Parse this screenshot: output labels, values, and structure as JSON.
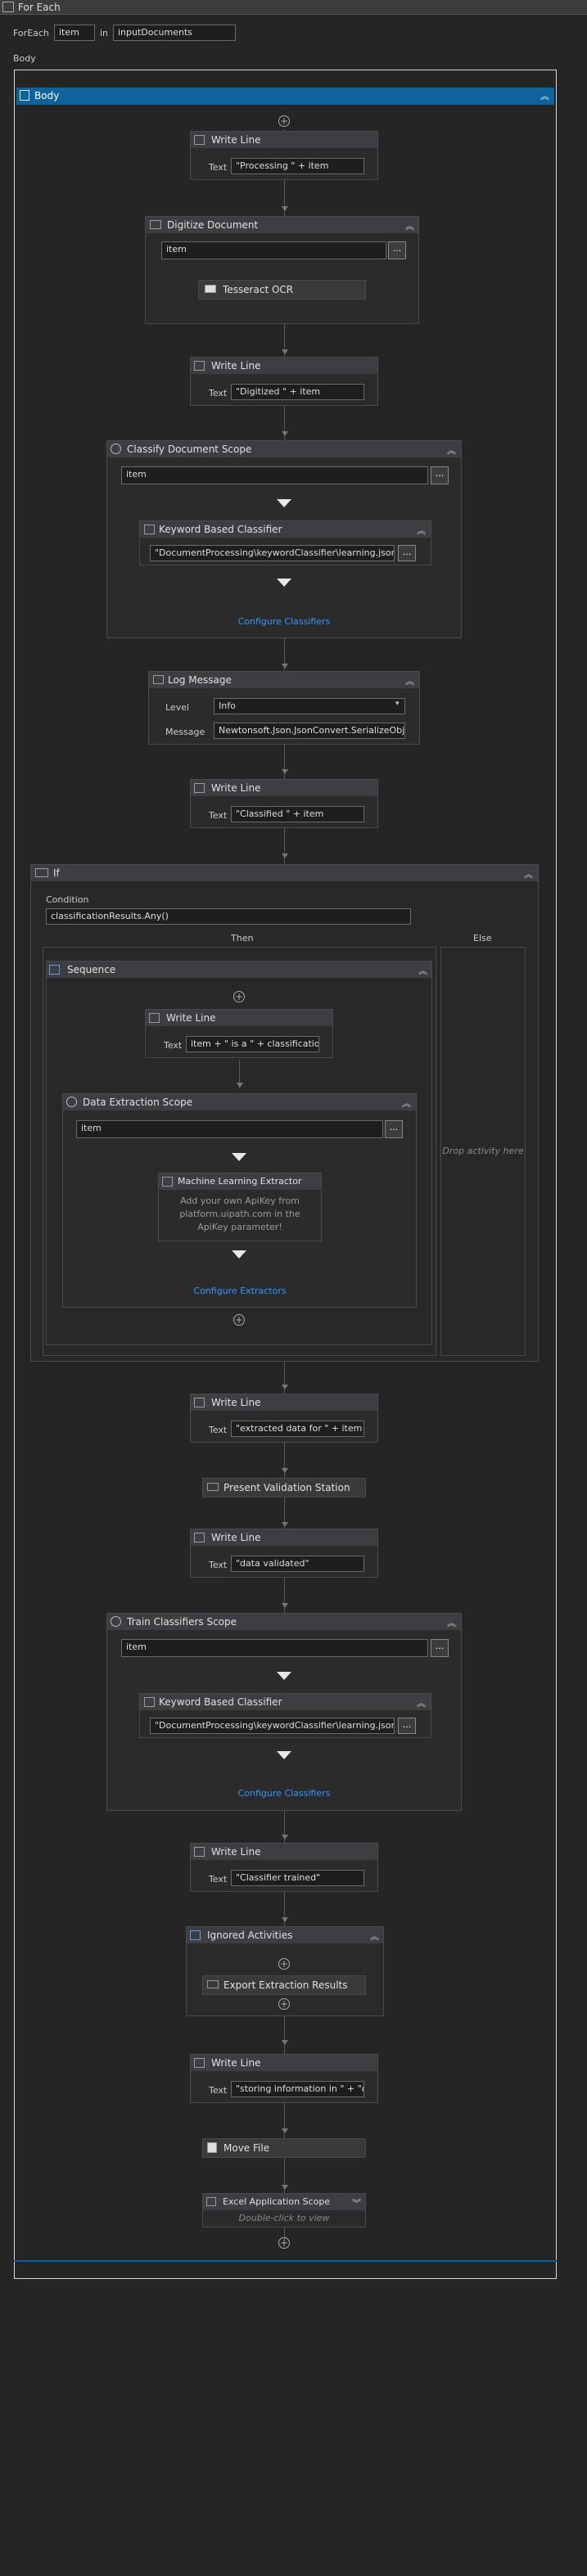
{
  "window": {
    "title": "For Each"
  },
  "foreach": {
    "label": "ForEach",
    "item_var": "item",
    "in_label": "in",
    "collection": "inputDocuments"
  },
  "body_label": "Body",
  "body_header": {
    "title": "Body"
  },
  "write1": {
    "title": "Write Line",
    "text_label": "Text",
    "text_value": "\"Processing \" + item"
  },
  "digitize": {
    "title": "Digitize Document",
    "input": "item",
    "ellipsis": "...",
    "ocr": "Tesseract OCR"
  },
  "write2": {
    "title": "Write Line",
    "text_label": "Text",
    "text_value": "\"Digitized \" + item"
  },
  "classify": {
    "title": "Classify Document Scope",
    "input": "item",
    "ellipsis": "...",
    "classifier_title": "Keyword Based Classifier",
    "classifier_path": "\"DocumentProcessing\\keywordClassifier\\learning.json\"",
    "configure": "Configure Classifiers"
  },
  "log": {
    "title": "Log Message",
    "level_label": "Level",
    "level_value": "Info",
    "message_label": "Message",
    "message_value": "Newtonsoft.Json.JsonConvert.SerializeObje"
  },
  "write3": {
    "title": "Write Line",
    "text_label": "Text",
    "text_value": "\"Classified \" + item"
  },
  "if_block": {
    "title": "If",
    "condition_label": "Condition",
    "condition_value": "classificationResults.Any()",
    "then_label": "Then",
    "else_label": "Else",
    "drop_hint": "Drop activity here"
  },
  "sequence": {
    "title": "Sequence"
  },
  "write4": {
    "title": "Write Line",
    "text_label": "Text",
    "text_value": "item + \" is a \" + classification"
  },
  "extraction": {
    "title": "Data Extraction Scope",
    "input": "item",
    "ellipsis": "...",
    "extractor_title": "Machine Learning Extractor",
    "extractor_desc": "Add your own ApiKey from platform.uipath.com in the ApiKey parameter!",
    "configure": "Configure Extractors"
  },
  "write5": {
    "title": "Write Line",
    "text_label": "Text",
    "text_value": "\"extracted data for \" + item"
  },
  "validation": {
    "title": "Present Validation Station"
  },
  "write6": {
    "title": "Write Line",
    "text_label": "Text",
    "text_value": "\"data validated\""
  },
  "train": {
    "title": "Train Classifiers Scope",
    "input": "item",
    "ellipsis": "...",
    "classifier_title": "Keyword Based Classifier",
    "classifier_path": "\"DocumentProcessing\\keywordClassifier\\learning.json\"",
    "configure": "Configure Classifiers"
  },
  "write7": {
    "title": "Write Line",
    "text_label": "Text",
    "text_value": "\"Classifier trained\""
  },
  "ignored": {
    "title": "Ignored Activities",
    "export": "Export Extraction Results"
  },
  "write8": {
    "title": "Write Line",
    "text_label": "Text",
    "text_value": "\"storing information in \" + \"o"
  },
  "movefile": {
    "title": "Move File"
  },
  "excel": {
    "title": "Excel Application Scope",
    "hint": "Double-click to view"
  }
}
